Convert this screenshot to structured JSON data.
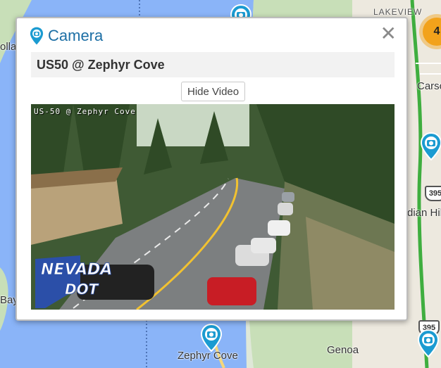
{
  "map": {
    "labels": {
      "lakeview": "LAKEVIEW",
      "carson": "Carso",
      "indian_hills": "dian Hil",
      "ollala": "olla",
      "bay": "Bay",
      "zephyr_cove": "Zephyr Cove",
      "genoa": "Genoa"
    },
    "cluster_count": "4",
    "highway_shields": [
      "395",
      "395"
    ]
  },
  "popup": {
    "title": "Camera",
    "location": "US50 @ Zephyr Cove",
    "hide_video_label": "Hide Video",
    "close_symbol": "✕",
    "video": {
      "overlay_text": "US-50 @ Zephyr Cove",
      "logo_text": "NEVADA DOT"
    }
  },
  "colors": {
    "accent": "#1d6fa5",
    "pin": "#1b9bd1",
    "cluster": "#f2a21b",
    "water": "#8ab4f8",
    "land": "#e8e6da"
  }
}
